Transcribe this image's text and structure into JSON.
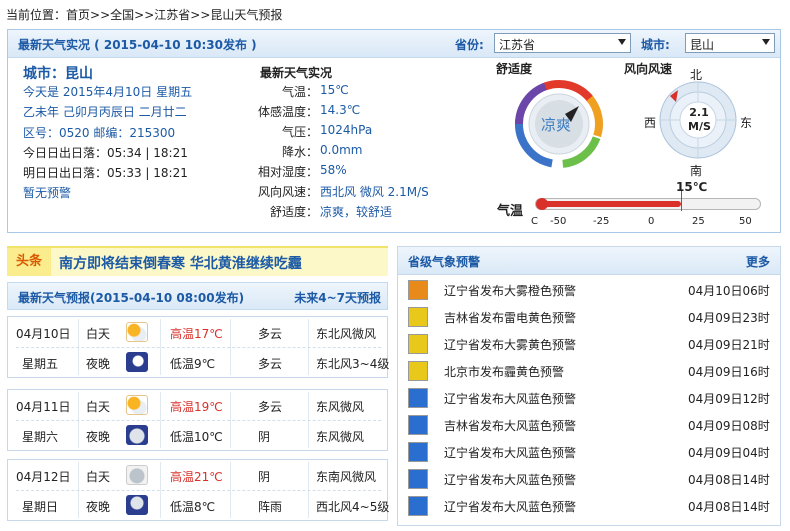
{
  "breadcrumb": {
    "prefix": "当前位置：",
    "items": [
      "首页",
      ">>全国",
      ">>江苏省",
      ">>昆山天气预报"
    ]
  },
  "top": {
    "title": "最新天气实况 ( 2015-04-10  10:30发布 )",
    "province_label": "省份:",
    "province_value": "江苏省",
    "city_label": "城市:",
    "city_value": "昆山"
  },
  "city_info": {
    "city": "城市：昆山",
    "today": "今天是 2015年4月10日 星期五",
    "lunar": "乙未年  己卯月丙辰日  二月廿二",
    "area_code": "区号：0520   邮编：215300",
    "sun_today": "今日日出日落：05:34  |  18:21",
    "sun_tomorrow": "明日日出日落：05:33  |  18:21",
    "warning": "暂无预警"
  },
  "live": {
    "title": "最新天气实况",
    "rows": [
      {
        "label": "气温：",
        "value": "15℃"
      },
      {
        "label": "体感温度：",
        "value": "14.3℃"
      },
      {
        "label": "气压：",
        "value": "1024hPa"
      },
      {
        "label": "降水：",
        "value": "0.0mm"
      },
      {
        "label": "相对湿度：",
        "value": "58%"
      },
      {
        "label": "风向风速：",
        "value": "西北风  微风  2.1M/S"
      },
      {
        "label": "舒适度：",
        "value": "凉爽，较舒适"
      }
    ]
  },
  "comfort": {
    "title": "舒适度",
    "value": "凉爽"
  },
  "wind": {
    "title": "风向风速",
    "speed": "2.1",
    "unit": "M/S",
    "n": "北",
    "s": "南",
    "e": "东",
    "w": "西"
  },
  "thermo": {
    "title": "气温",
    "current": "15℃",
    "ticks": [
      "C",
      "-50",
      "-25",
      "0",
      "25",
      "50"
    ],
    "value": 15
  },
  "headline": {
    "tag": "头条",
    "text": "南方即将结束倒春寒  华北黄淮继续吃霾"
  },
  "forecast": {
    "title": "最新天气预报(2015-04-10  08:00发布)",
    "more": "未来4~7天预报",
    "days": [
      {
        "date": "04月10日",
        "weekday": "星期五",
        "day": {
          "period": "白天",
          "temp": "高温17℃",
          "weather": "多云",
          "wind": "东北风微风",
          "icon": "partly-cloudy-icon"
        },
        "night": {
          "period": "夜晚",
          "temp": "低温9℃",
          "weather": "多云",
          "wind": "东北风3~4级",
          "icon": "moon-cloud-icon"
        }
      },
      {
        "date": "04月11日",
        "weekday": "星期六",
        "day": {
          "period": "白天",
          "temp": "高温19℃",
          "weather": "多云",
          "wind": "东风微风",
          "icon": "partly-cloudy-icon"
        },
        "night": {
          "period": "夜晚",
          "temp": "低温10℃",
          "weather": "阴",
          "wind": "东风微风",
          "icon": "overcast-night-icon"
        }
      },
      {
        "date": "04月12日",
        "weekday": "星期日",
        "day": {
          "period": "白天",
          "temp": "高温21℃",
          "weather": "阴",
          "wind": "东南风微风",
          "icon": "overcast-icon"
        },
        "night": {
          "period": "夜晚",
          "temp": "低温8℃",
          "weather": "阵雨",
          "wind": "西北风4~5级",
          "icon": "shower-icon"
        }
      }
    ]
  },
  "alerts": {
    "title": "省级气象预警",
    "more": "更多",
    "items": [
      {
        "text": "辽宁省发布大雾橙色预警",
        "time": "04月10日06时",
        "color": "#e88a1a"
      },
      {
        "text": "吉林省发布雷电黄色预警",
        "time": "04月09日23时",
        "color": "#e8c81a"
      },
      {
        "text": "辽宁省发布大雾黄色预警",
        "time": "04月09日21时",
        "color": "#e8c81a"
      },
      {
        "text": "北京市发布霾黄色预警",
        "time": "04月09日16时",
        "color": "#e8c81a"
      },
      {
        "text": "辽宁省发布大风蓝色预警",
        "time": "04月09日12时",
        "color": "#2a6fd0"
      },
      {
        "text": "吉林省发布大风蓝色预警",
        "time": "04月09日08时",
        "color": "#2a6fd0"
      },
      {
        "text": "辽宁省发布大风蓝色预警",
        "time": "04月09日04时",
        "color": "#2a6fd0"
      },
      {
        "text": "辽宁省发布大风蓝色预警",
        "time": "04月08日14时",
        "color": "#2a6fd0"
      },
      {
        "text": "辽宁省发布大风蓝色预警",
        "time": "04月08日14时",
        "color": "#2a6fd0"
      }
    ]
  }
}
